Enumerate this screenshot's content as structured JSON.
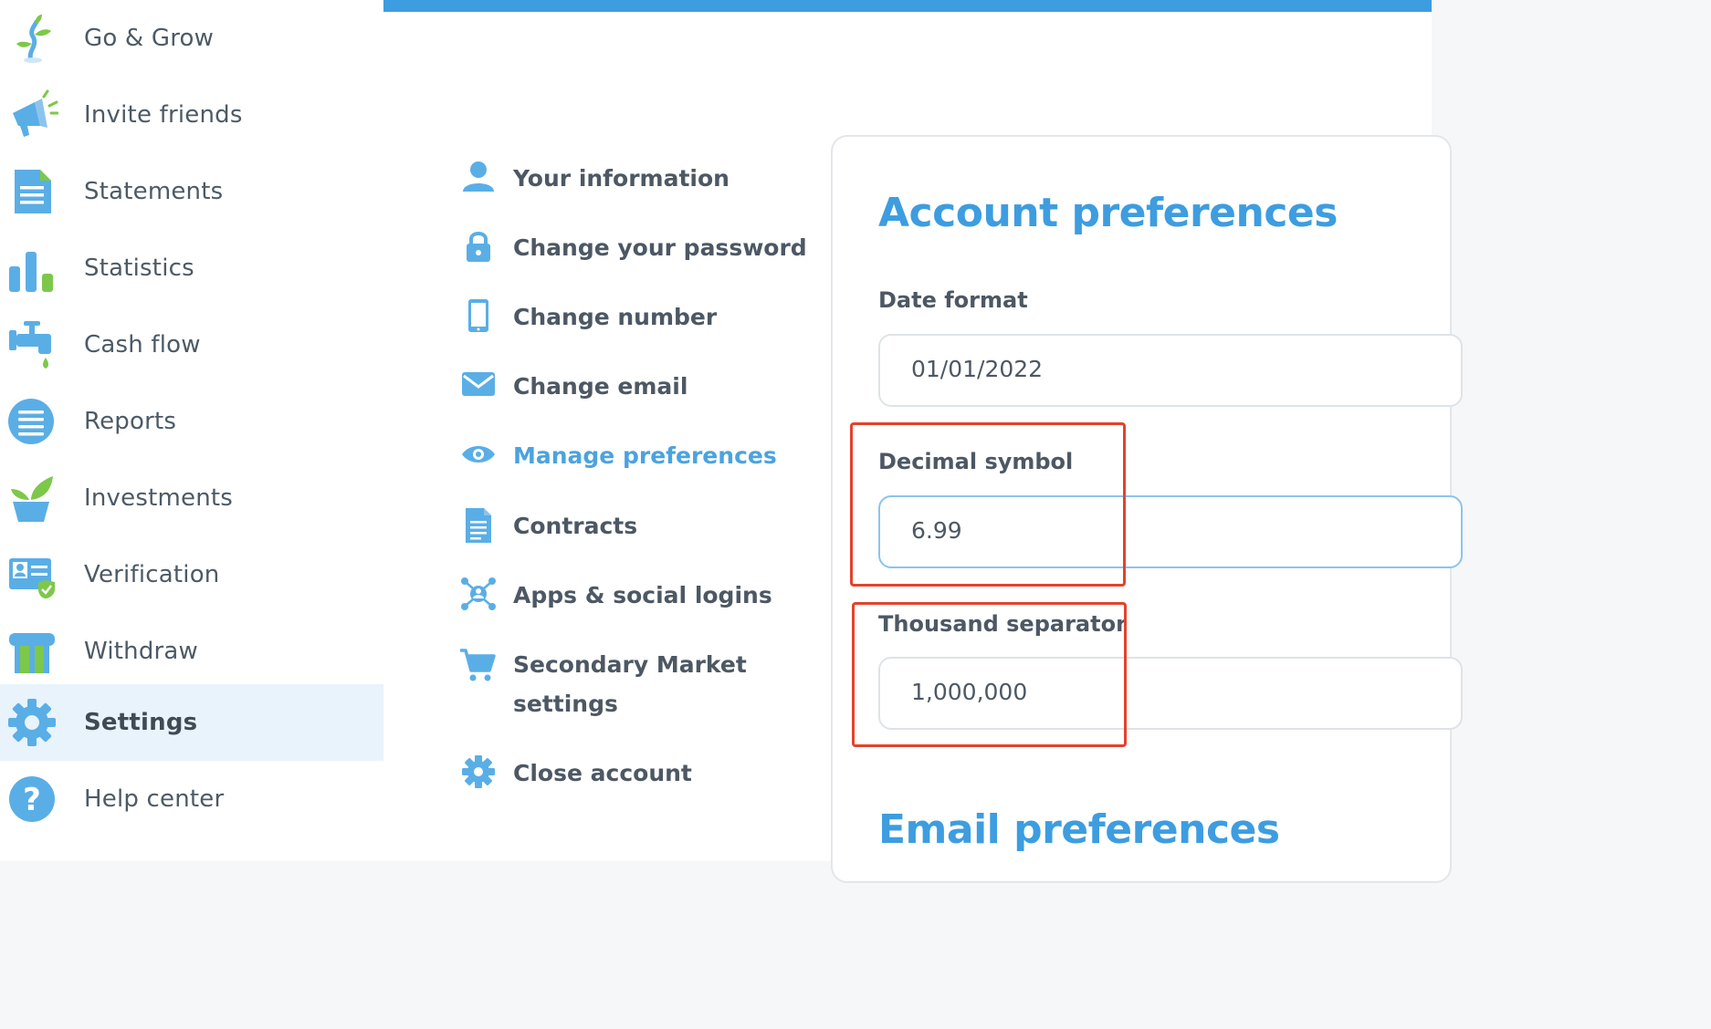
{
  "sidebar": {
    "items": [
      {
        "label": "Go & Grow",
        "icon": "sprout-icon"
      },
      {
        "label": "Invite friends",
        "icon": "megaphone-icon"
      },
      {
        "label": "Statements",
        "icon": "document-icon"
      },
      {
        "label": "Statistics",
        "icon": "bar-chart-icon"
      },
      {
        "label": "Cash flow",
        "icon": "faucet-icon"
      },
      {
        "label": "Reports",
        "icon": "list-icon"
      },
      {
        "label": "Investments",
        "icon": "plant-pot-icon"
      },
      {
        "label": "Verification",
        "icon": "id-card-icon"
      },
      {
        "label": "Withdraw",
        "icon": "atm-icon"
      },
      {
        "label": "Settings",
        "icon": "gear-icon",
        "active": true
      },
      {
        "label": "Help center",
        "icon": "question-icon"
      }
    ]
  },
  "settings_menu": {
    "items": [
      {
        "label": "Your information",
        "icon": "user-icon"
      },
      {
        "label": "Change your password",
        "icon": "lock-icon"
      },
      {
        "label": "Change number",
        "icon": "phone-icon"
      },
      {
        "label": "Change email",
        "icon": "envelope-icon"
      },
      {
        "label": "Manage preferences",
        "icon": "eye-icon",
        "active": true
      },
      {
        "label": "Contracts",
        "icon": "document-icon"
      },
      {
        "label": "Apps & social logins",
        "icon": "network-icon"
      },
      {
        "label_line1": "Secondary Market",
        "label_line2": "settings",
        "icon": "cart-icon"
      },
      {
        "label": "Close account",
        "icon": "gear-icon"
      }
    ]
  },
  "account_preferences": {
    "title": "Account preferences",
    "date_format": {
      "label": "Date format",
      "value": "01/01/2022"
    },
    "decimal_symbol": {
      "label": "Decimal symbol",
      "value": "6.99"
    },
    "thousand_separator": {
      "label": "Thousand separator",
      "value": "1,000,000"
    }
  },
  "email_preferences": {
    "title": "Email preferences"
  },
  "colors": {
    "accent": "#3d9de0",
    "icon_blue": "#5aaee6",
    "icon_green": "#7dc84a",
    "active_bg": "#e8f3fb",
    "highlight": "#e2432c"
  }
}
